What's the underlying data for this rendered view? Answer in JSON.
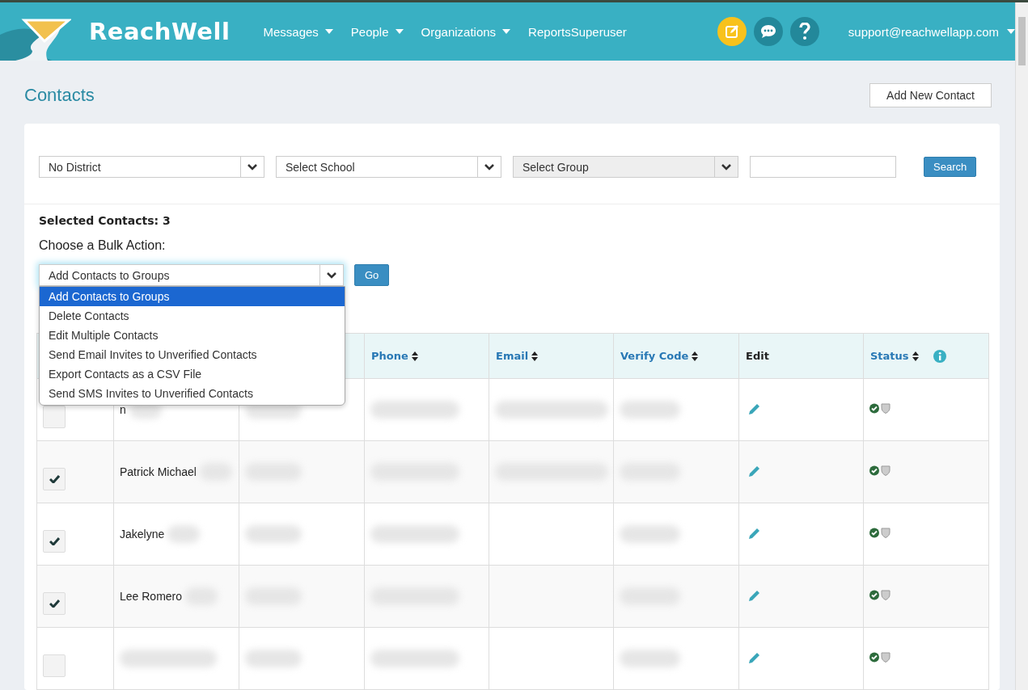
{
  "header": {
    "brand": "ReachWell",
    "nav": [
      {
        "label": "Messages",
        "dropdown": true
      },
      {
        "label": "People",
        "dropdown": true
      },
      {
        "label": "Organizations",
        "dropdown": true
      },
      {
        "label": "ReportsSuperuser",
        "dropdown": false
      }
    ],
    "actions": [
      {
        "kind": "compose",
        "color": "#f8c21c"
      },
      {
        "kind": "chat",
        "color": "#23889a"
      },
      {
        "kind": "help",
        "color": "#23889a"
      }
    ],
    "user": "support@reachwellapp.com"
  },
  "page_title": "Contacts",
  "add_button": "Add New Contact",
  "filters": [
    {
      "kind": "select",
      "value": "No District",
      "disabled": false
    },
    {
      "kind": "select",
      "value": "Select School",
      "disabled": false
    },
    {
      "kind": "select",
      "value": "Select Group",
      "disabled": true
    },
    {
      "kind": "text"
    }
  ],
  "search_button": "Search",
  "selected_label": "Selected Contacts: 3",
  "bulk_label": "Choose a Bulk Action:",
  "bulk_select": {
    "value": "Add Contacts to Groups",
    "expanded": true
  },
  "go_button": "Go",
  "bulk_options": [
    {
      "label": "Add Contacts to Groups",
      "selected": true
    },
    {
      "label": "Delete Contacts",
      "selected": false
    },
    {
      "label": "Edit Multiple Contacts",
      "selected": false
    },
    {
      "label": "Send Email Invites to Unverified Contacts",
      "selected": false
    },
    {
      "label": "Export Contacts as a CSV File",
      "selected": false
    },
    {
      "label": "Send SMS Invites to Unverified Contacts",
      "selected": false
    }
  ],
  "columns": [
    {
      "label": "Phone",
      "sortable": true,
      "info": false
    },
    {
      "label": "Email",
      "sortable": true,
      "info": false
    },
    {
      "label": "Verify Code",
      "sortable": true,
      "info": false
    },
    {
      "label": "Edit",
      "sortable": false,
      "info": false
    },
    {
      "label": "Status",
      "sortable": true,
      "info": true
    }
  ],
  "rows": [
    {
      "checked": false,
      "name": "n",
      "email_redacted": true
    },
    {
      "checked": true,
      "name": "Patrick Michael",
      "email_redacted": true
    },
    {
      "checked": true,
      "name": "Jakelyne",
      "email_redacted": false
    },
    {
      "checked": true,
      "name": "Lee Romero",
      "email_redacted": false
    },
    {
      "checked": false,
      "email_redacted": false
    }
  ]
}
